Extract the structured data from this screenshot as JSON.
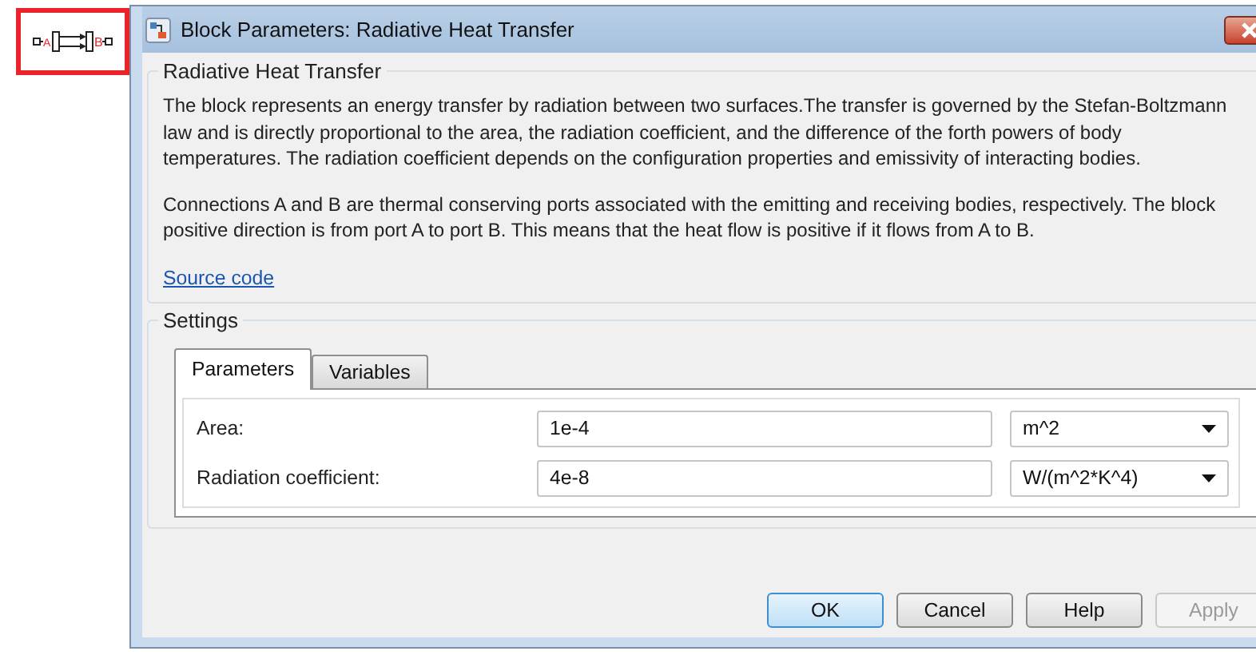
{
  "block": {
    "ports": [
      "A",
      "B"
    ],
    "selected": true
  },
  "window": {
    "title": "Block Parameters: Radiative Heat Transfer"
  },
  "description": {
    "title": "Radiative Heat Transfer",
    "paragraphs": [
      "The block represents an energy transfer by radiation between two surfaces.The transfer is governed by the Stefan-Boltzmann law and is directly proportional to the area, the radiation coefficient, and the difference of the forth powers of body temperatures. The radiation coefficient depends on the configuration properties and emissivity of interacting bodies.",
      "Connections A and B are thermal conserving ports associated with the emitting and receiving bodies, respectively. The block positive direction is from port A to port B. This means that the heat flow is positive if it flows from A to B."
    ],
    "link": "Source code"
  },
  "settings": {
    "title": "Settings",
    "tabs": [
      {
        "label": "Parameters",
        "selected": true
      },
      {
        "label": "Variables",
        "selected": false
      }
    ],
    "parameters": [
      {
        "label": "Area:",
        "value": "1e-4",
        "unit": "m^2"
      },
      {
        "label": "Radiation coefficient:",
        "value": "4e-8",
        "unit": "W/(m^2*K^4)"
      }
    ]
  },
  "buttons": [
    {
      "label": "OK",
      "default": true,
      "disabled": false
    },
    {
      "label": "Cancel",
      "default": false,
      "disabled": false
    },
    {
      "label": "Help",
      "default": false,
      "disabled": false
    },
    {
      "label": "Apply",
      "default": false,
      "disabled": true
    }
  ]
}
